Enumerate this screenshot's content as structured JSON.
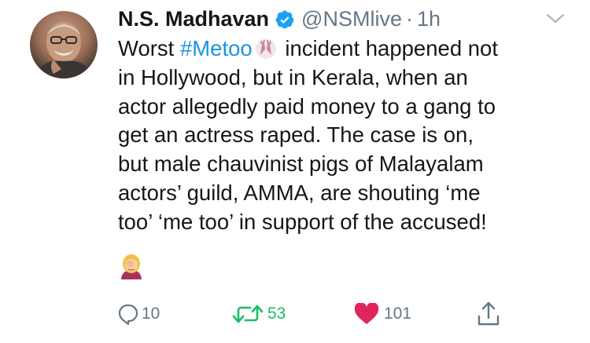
{
  "tweet": {
    "display_name": "N.S. Madhavan",
    "handle": "@NSMlive",
    "separator": "·",
    "timestamp": "1h",
    "text_start": "Worst ",
    "hashtag": "#Metoo",
    "text_rest": " incident happened not\nin Hollywood, but in Kerala, when an\nactor allegedly paid money to a gang to\nget an actress raped. The case is on,\nbut male chauvinist pigs of Malayalam\nactors’ guild, AMMA, are shouting ‘me\ntoo’ ‘me too’ in support of the accused!",
    "icons": {
      "verified": "verified-badge-icon",
      "inline_emoji": "raised-hands-emoji",
      "trailing_emoji": "facepalm-woman-emoji",
      "menu": "chevron-down-icon"
    }
  },
  "actions": {
    "reply_count": "10",
    "retweet_count": "53",
    "like_count": "101"
  },
  "colors": {
    "link": "#1b95e0",
    "secondary_text": "#657786",
    "retweet_active": "#17bf63",
    "like_active": "#e0245e"
  }
}
